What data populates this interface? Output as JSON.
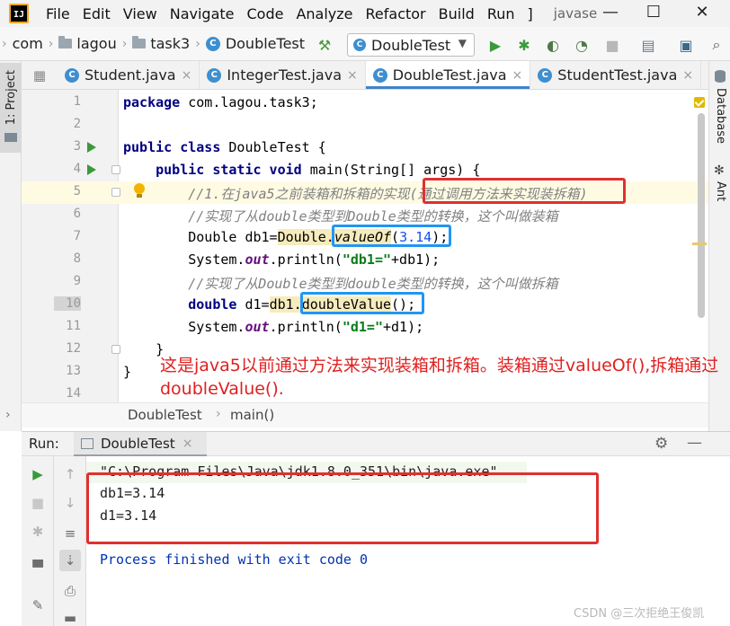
{
  "menu": {
    "items": [
      "File",
      "Edit",
      "View",
      "Navigate",
      "Code",
      "Analyze",
      "Refactor",
      "Build",
      "Run",
      "]"
    ],
    "project_name": "javase"
  },
  "window_controls": {
    "minimize": "—",
    "maximize": "☐",
    "close": "✕"
  },
  "nav": {
    "breadcrumb": [
      "com",
      "lagou",
      "task3",
      "DoubleTest"
    ],
    "run_config": "DoubleTest"
  },
  "side": {
    "project_tab": "1: Project",
    "database_tab": "Database",
    "ant_tab": "Ant"
  },
  "tabs": [
    {
      "label": "Student.java",
      "active": false
    },
    {
      "label": "IntegerTest.java",
      "active": false
    },
    {
      "label": "DoubleTest.java",
      "active": true
    },
    {
      "label": "StudentTest.java",
      "active": false
    }
  ],
  "code": {
    "line_numbers": [
      "1",
      "2",
      "3",
      "4",
      "5",
      "6",
      "7",
      "8",
      "9",
      "10",
      "11",
      "12",
      "13",
      "14"
    ],
    "l1_kw": "package",
    "l1_rest": " com.lagou.task3;",
    "l3_kw": "public class",
    "l3_rest": " DoubleTest {",
    "l4_kw": "public static void",
    "l4_rest": " main(String[] args) {",
    "l5_cm": "//1.在java5之前装箱和拆箱的实现",
    "l5_cm2": "(通过调用方法来实现装拆箱)",
    "l6_cm": "//实现了从double类型到Double类型的转换，这个叫做装箱",
    "l7_a": "Double db1=",
    "l7_b": "Double",
    "l7_c": ".",
    "l7_d": "valueOf",
    "l7_e": "(",
    "l7_f": "3.14",
    "l7_g": ");",
    "l8_a": "System.",
    "l8_b": "out",
    "l8_c": ".println(",
    "l8_d": "\"db1=\"",
    "l8_e": "+db1);",
    "l9_cm": "//实现了从Double类型到double类型的转换，这个叫做拆箱",
    "l10_kw": "double",
    "l10_a": " d1=",
    "l10_b": "db1",
    "l10_c": ".",
    "l10_d": "doubleValue",
    "l10_e": "();",
    "l11_a": "System.",
    "l11_b": "out",
    "l11_c": ".println(",
    "l11_d": "\"d1=\"",
    "l11_e": "+d1);",
    "l12": "}",
    "l13": "}"
  },
  "annotation": "这是java5以前通过方法来实现装箱和拆箱。装箱通过valueOf(),拆箱通过doubleValue().",
  "breadcrumb_bottom": {
    "class": "DoubleTest",
    "sep": "›",
    "method": "main()"
  },
  "run": {
    "label": "Run:",
    "tab": "DoubleTest",
    "command": "\"C:\\Program Files\\Java\\jdk1.8.0_351\\bin\\java.exe\"",
    "output": [
      "db1=3.14",
      "d1=3.14"
    ],
    "exit": "Process finished with exit code 0"
  },
  "watermark": "CSDN @三次拒绝王俊凯"
}
